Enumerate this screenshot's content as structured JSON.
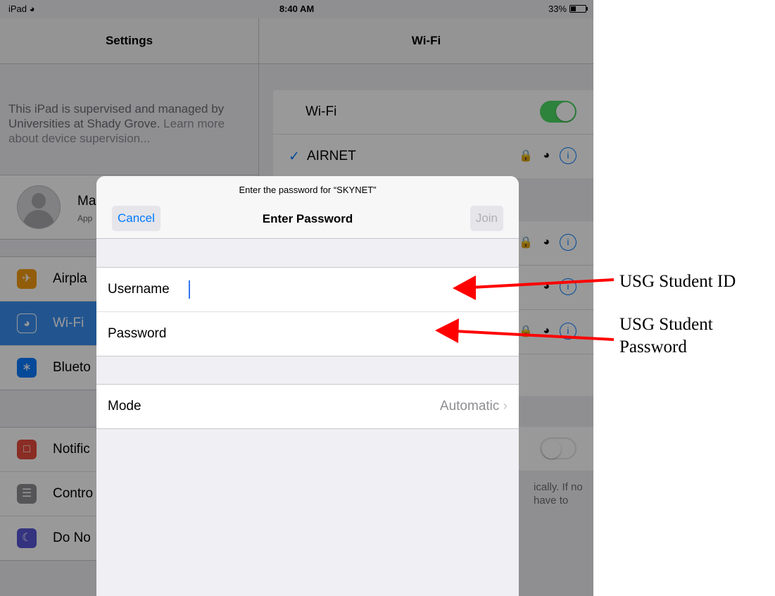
{
  "status_bar": {
    "device": "iPad",
    "time": "8:40 AM",
    "battery": "33%",
    "battery_level": 0.33
  },
  "settings_pane": {
    "title": "Settings",
    "supervision_text": "This iPad is supervised and managed by Universities at Shady Grove.",
    "supervision_link": "Learn more about device supervision...",
    "profile": {
      "name": "Ma",
      "subtitle": "App"
    },
    "group1": [
      {
        "label": "Airpla",
        "icon": "airplane-icon",
        "color": "#f39c12"
      },
      {
        "label": "Wi-Fi",
        "icon": "wifi-icon",
        "color": "#3a8ef0",
        "active": true
      },
      {
        "label": "Blueto",
        "icon": "bluetooth-icon",
        "color": "#0a7aff"
      }
    ],
    "group2": [
      {
        "label": "Notific",
        "icon": "notifications-icon",
        "color": "#e74c3c"
      },
      {
        "label": "Contro",
        "icon": "control-center-icon",
        "color": "#8e8e93"
      },
      {
        "label": "Do No",
        "icon": "moon-icon",
        "color": "#5856d6"
      }
    ]
  },
  "wifi_pane": {
    "title": "Wi-Fi",
    "wifi_label": "Wi-Fi",
    "wifi_on": true,
    "connected_network": "AIRNET",
    "footer_text": "ically. If no\nhave to"
  },
  "dialog": {
    "prompt": "Enter the password for “SKYNET”",
    "title": "Enter Password",
    "cancel_label": "Cancel",
    "join_label": "Join",
    "username_label": "Username",
    "password_label": "Password",
    "mode_label": "Mode",
    "mode_value": "Automatic"
  },
  "annotations": {
    "username_note": "USG Student ID",
    "password_note_line1": "USG Student",
    "password_note_line2": "Password",
    "arrow_color": "#ff0000"
  }
}
